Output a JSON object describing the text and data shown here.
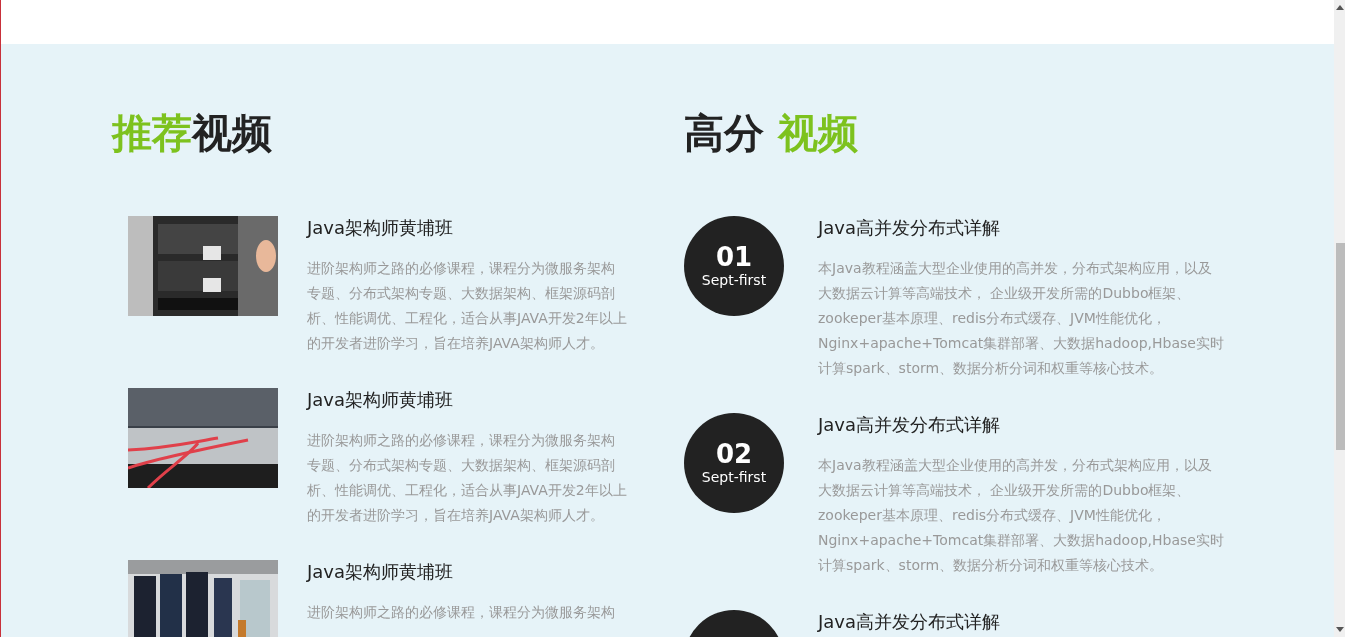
{
  "recommended": {
    "heading": [
      {
        "text": "推荐",
        "accent": true
      },
      {
        "text": "视频",
        "accent": false
      }
    ],
    "items": [
      {
        "title": "Java架构师黄埔班",
        "description": "进阶架构师之路的必修课程，课程分为微服务架构专题、分布式架构专题、大数据架构、框架源码剖析、性能调优、工程化，适合从事JAVA开发2年以上的开发者进阶学习，旨在培养JAVA架构师人才。"
      },
      {
        "title": "Java架构师黄埔班",
        "description": "进阶架构师之路的必修课程，课程分为微服务架构专题、分布式架构专题、大数据架构、框架源码剖析、性能调优、工程化，适合从事JAVA开发2年以上的开发者进阶学习，旨在培养JAVA架构师人才。"
      },
      {
        "title": "Java架构师黄埔班",
        "description": "进阶架构师之路的必修课程，课程分为微服务架构"
      }
    ]
  },
  "top_rated": {
    "heading": [
      {
        "text": "高分",
        "accent": false
      },
      {
        "text": " 视频",
        "accent": true
      }
    ],
    "items": [
      {
        "number": "01",
        "label": "Sept-first",
        "title": "Java高并发分布式详解",
        "description": "本Java教程涵盖大型企业使用的高并发，分布式架构应用，以及大数据云计算等高端技术， 企业级开发所需的Dubbo框架、zookeper基本原理、redis分布式缓存、JVM性能优化，Nginx+apache+Tomcat集群部署、大数据hadoop,Hbase实时计算spark、storm、数据分析分词和权重等核心技术。"
      },
      {
        "number": "02",
        "label": "Sept-first",
        "title": "Java高并发分布式详解",
        "description": "本Java教程涵盖大型企业使用的高并发，分布式架构应用，以及大数据云计算等高端技术， 企业级开发所需的Dubbo框架、zookeper基本原理、redis分布式缓存、JVM性能优化，Nginx+apache+Tomcat集群部署、大数据hadoop,Hbase实时计算spark、storm、数据分析分词和权重等核心技术。"
      },
      {
        "title": "Java高并发分布式详解"
      }
    ]
  }
}
